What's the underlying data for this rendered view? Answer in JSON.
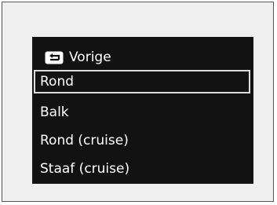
{
  "menu": {
    "back_label": "Vorige",
    "back_icon": "back-arrow-icon",
    "items": [
      {
        "label": "Rond",
        "selected": true
      },
      {
        "label": "Balk",
        "selected": false
      },
      {
        "label": "Rond (cruise)",
        "selected": false
      },
      {
        "label": "Staaf (cruise)",
        "selected": false
      }
    ],
    "colors": {
      "screen_background": "#121212",
      "text": "#ffffff",
      "selection_border": "#dcdcdc",
      "frame_background": "#efefef"
    }
  }
}
